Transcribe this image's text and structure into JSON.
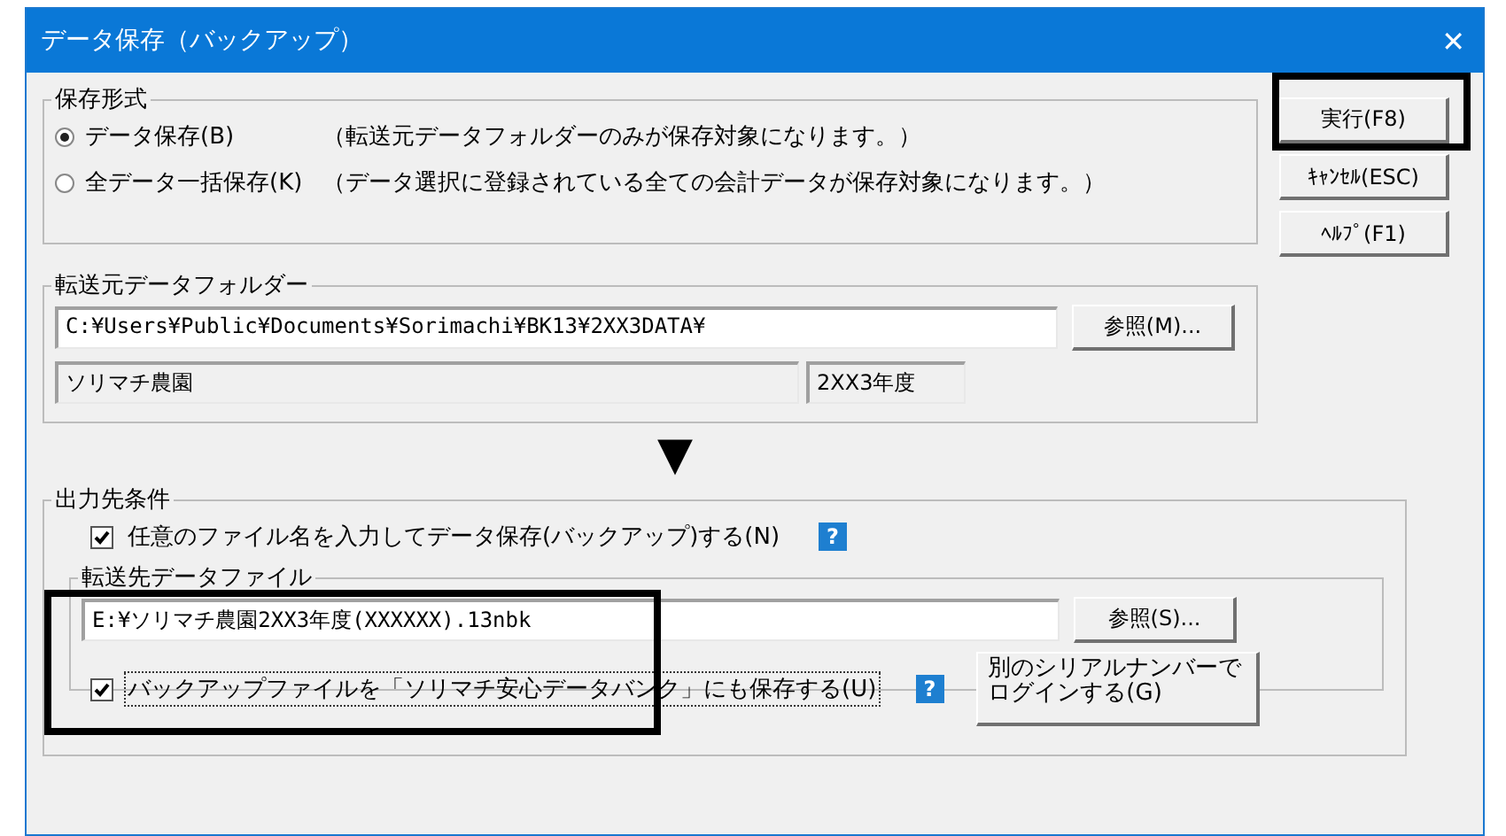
{
  "window": {
    "title": "データ保存（バックアップ）",
    "close": "✕"
  },
  "save_format": {
    "title": "保存形式",
    "options": [
      {
        "label": "データ保存(B)",
        "note": "（転送元データフォルダーのみが保存対象になります。）",
        "selected": true
      },
      {
        "label": "全データ一括保存(K)",
        "note": "（データ選択に登録されている全ての会計データが保存対象になります。）",
        "selected": false
      }
    ]
  },
  "source_folder": {
    "title": "転送元データフォルダー",
    "path": "C:¥Users¥Public¥Documents¥Sorimachi¥BK13¥2XX3DATA¥",
    "browse": "参照(M)...",
    "company": "ソリマチ農園",
    "year": "2XX3年度"
  },
  "arrow": "▼",
  "output": {
    "title": "出力先条件",
    "custom_name": {
      "label": "任意のファイル名を入力してデータ保存(バックアップ)する(N)",
      "checked": true,
      "help": "?"
    },
    "dest_file": {
      "title": "転送先データファイル",
      "path": "E:¥ソリマチ農園2XX3年度(XXXXXX).13nbk",
      "browse": "参照(S)..."
    },
    "databank": {
      "label": "バックアップファイルを「ソリマチ安心データバンク」にも保存する(U)",
      "checked": true,
      "help": "?"
    },
    "login": [
      "別のシリアルナンバーで",
      "ログインする(G)"
    ]
  },
  "buttons": [
    {
      "label": "実行(F8)",
      "highlighted": true
    },
    {
      "label": "ｷｬﾝｾﾙ(ESC)",
      "highlighted": false
    },
    {
      "label": "ﾍﾙﾌﾟ(F1)",
      "highlighted": false
    }
  ]
}
